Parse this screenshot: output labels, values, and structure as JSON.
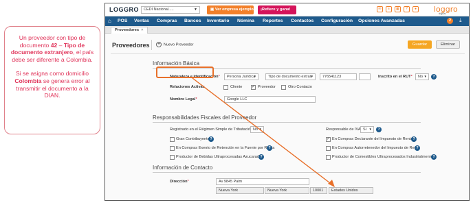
{
  "note": {
    "p1_a": "Un proveedor con tipo de documento ",
    "p1_num": "42",
    "p1_b": " – ",
    "p1_doc": "Tipo de documento extranjero",
    "p1_c": ", el país debe ser diferente a Colombia.",
    "p2_a": "Si se asigna como domicilio ",
    "p2_country": "Colombia",
    "p2_b": " se genera error al transmitir el documento a la DIAN."
  },
  "topbar": {
    "logo": "LOGGRO",
    "company": "CEDI Nacional.....",
    "demo_button": "Ver empresa ejemplo",
    "go_button": "¡Refiere y gana!",
    "brand_main": "loggro",
    "brand_sub": "digital"
  },
  "nav": {
    "items": [
      "POS",
      "Ventas",
      "Compras",
      "Bancos",
      "Inventario",
      "Nómina",
      "Reportes",
      "Contactos",
      "Configuración",
      "Opciones Avanzadas"
    ],
    "badge": "2"
  },
  "tab": {
    "label": "Proveedores",
    "close": "×"
  },
  "page": {
    "title": "Proveedores",
    "new_label": "Nuevo Proveedor",
    "save": "Guardar",
    "delete": "Eliminar"
  },
  "basic": {
    "heading": "Información Básica",
    "naturaleza_label": "Naturaleza e Identificación",
    "naturaleza_value": "Persona Jurídica",
    "tipo_doc_value": "Tipo de documento extran",
    "id_number": "776541123",
    "dv": "",
    "rut_label": "Inscrito en el RUT",
    "rut_value": "No",
    "relaciones_label": "Relaciones Activas",
    "rel_cliente": "Cliente",
    "rel_proveedor": "Proveedor",
    "rel_otro": "Otro Contacto",
    "nombre_label": "Nombre Legal",
    "nombre_value": "Google LLC"
  },
  "fiscal": {
    "heading": "Responsabilidades Fiscales del Proveedor",
    "simple_label": "Registrado en el Régimen Simple de Tributación",
    "simple_value": "No",
    "iva_label": "Responsable de IVA",
    "iva_value": "Sí",
    "left": [
      {
        "label": "Gran Contribuyente",
        "checked": "",
        "help": "?"
      },
      {
        "label": "En Compras Exento de Retención en la Fuente por Renta",
        "checked": "",
        "help": "?"
      },
      {
        "label": "Productor de Bebidas Ultraprocesadas Azucaradas",
        "checked": "",
        "help": "?"
      }
    ],
    "right": [
      {
        "label": "En Compras Declarante del Impuesto de Renta",
        "checked": "✓",
        "help": "?"
      },
      {
        "label": "En Compras Autorretenedor del Impuesto de Renta",
        "checked": "",
        "help": "?"
      },
      {
        "label": "Productor de Comestibles Ultraprocesados Industrialmente",
        "checked": "",
        "help": "?"
      }
    ]
  },
  "contact": {
    "heading": "Información de Contacto",
    "direccion_label": "Dirección",
    "address": "Av 9845 Palm",
    "city": "Nueva York",
    "state": "Nueva York",
    "zip": "10001",
    "country": "Estados Unidos"
  },
  "colors": {
    "accent_orange": "#f2802a",
    "nav_blue": "#1e5a8c",
    "note_pink": "#e0345a",
    "cta_magenta": "#d4145a"
  }
}
